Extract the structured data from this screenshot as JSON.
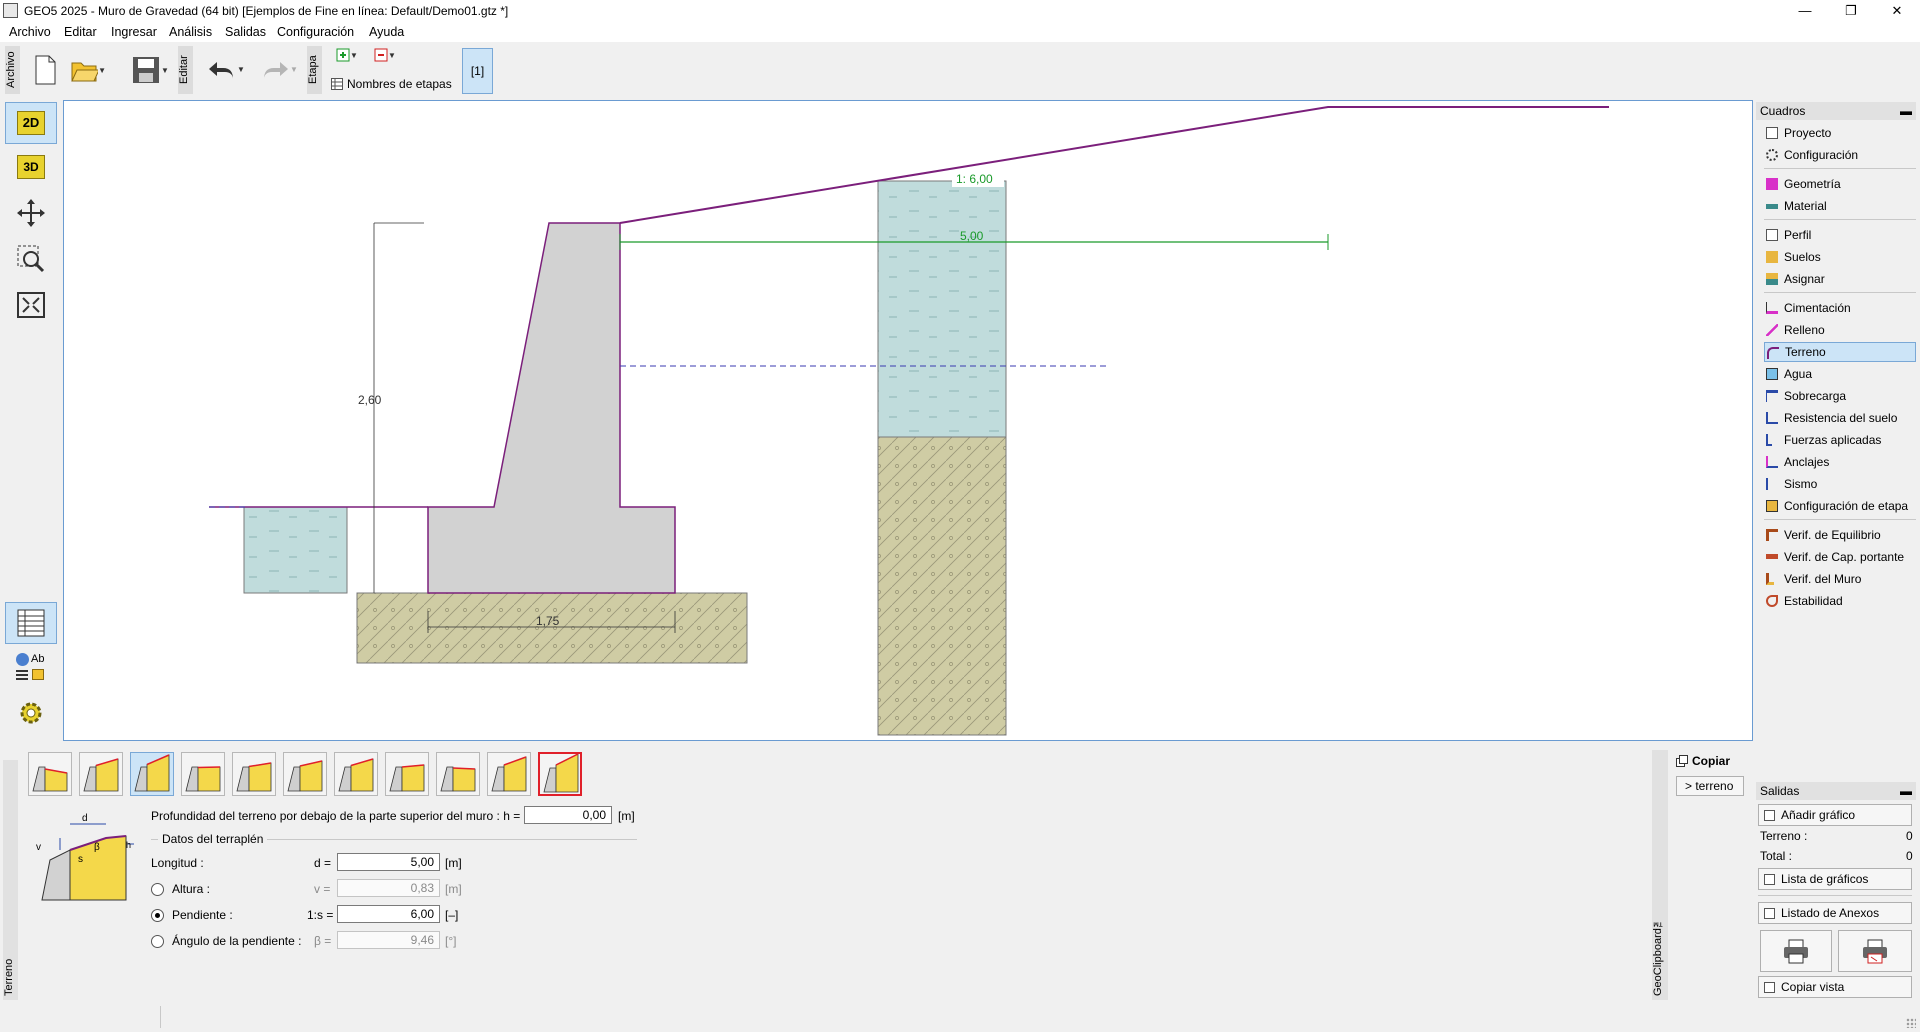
{
  "window": {
    "title": "GEO5 2025 - Muro de Gravedad (64 bit) [Ejemplos de Fine en línea: Default/Demo01.gtz *]"
  },
  "menu": [
    "Archivo",
    "Editar",
    "Ingresar",
    "Análisis",
    "Salidas",
    "Configuración",
    "Ayuda"
  ],
  "toolbar": {
    "archivo_label": "Archivo",
    "editar_label": "Editar",
    "etapa_label": "Etapa",
    "stage_names_label": "Nombres de etapas",
    "stage_number": "[1]"
  },
  "leftbar": {
    "btn_2d": "2D",
    "btn_3d": "3D",
    "btn_ab": "Ab"
  },
  "drawing": {
    "height_dim": "2,60",
    "base_dim": "1,75",
    "terrain_length_dim": "5,00",
    "slope_label": "1: 6,00"
  },
  "frames": {
    "header": "Cuadros",
    "items": [
      "Proyecto",
      "Configuración",
      "Geometría",
      "Material",
      "Perfil",
      "Suelos",
      "Asignar",
      "Cimentación",
      "Relleno",
      "Terreno",
      "Agua",
      "Sobrecarga",
      "Resistencia del suelo",
      "Fuerzas aplicadas",
      "Anclajes",
      "Sismo",
      "Configuración de etapa",
      "Verif. de Equilibrio",
      "Verif. de Cap. portante",
      "Verif. del Muro",
      "Estabilidad"
    ],
    "selected": "Terreno"
  },
  "outputs": {
    "header": "Salidas",
    "add_graphic": "Añadir gráfico",
    "terrain_label": "Terreno :",
    "terrain_count": "0",
    "total_label": "Total :",
    "total_count": "0",
    "graphics_list": "Lista de gráficos",
    "annex_list": "Listado de Anexos",
    "copy_view": "Copiar vista"
  },
  "terrain_panel": {
    "side_label": "Terreno",
    "clipboard_label": "GeoClipboard™",
    "copy_label": "Copiar",
    "copy_target": "> terreno",
    "depth_label": "Profundidad del terreno por debajo de la parte superior del muro : h =",
    "depth_value": "0,00",
    "depth_unit": "[m]",
    "group_label": "Datos del terraplén",
    "length_label": "Longitud :",
    "length_sym": "d =",
    "length_value": "5,00",
    "length_unit": "[m]",
    "height_label": "Altura :",
    "height_sym": "v =",
    "height_value": "0,83",
    "height_unit": "[m]",
    "slope_label": "Pendiente :",
    "slope_sym": "1:s =",
    "slope_value": "6,00",
    "slope_unit": "[–]",
    "angle_label": "Ángulo de la pendiente :",
    "angle_sym": "β =",
    "angle_value": "9,46",
    "angle_unit": "[°]",
    "diagram_d": "d",
    "diagram_v": "v",
    "diagram_beta": "β",
    "diagram_s": "s",
    "diagram_h": "h"
  }
}
